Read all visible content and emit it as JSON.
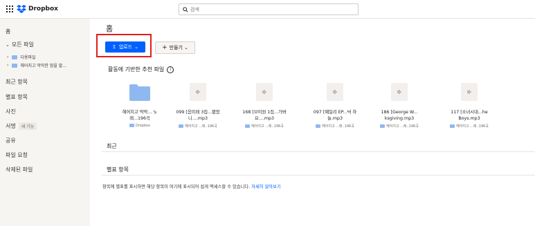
{
  "topbar": {
    "app_name": "Dropbox",
    "search_placeholder": "검색"
  },
  "sidebar": {
    "home": "홈",
    "all_files": "모든 파일",
    "tree": [
      {
        "label": "다용파일"
      },
      {
        "label": "헤어지고 막막한 맘을 말..."
      }
    ],
    "items": [
      {
        "label": "최근 항목"
      },
      {
        "label": "별표 항목"
      },
      {
        "label": "사진"
      },
      {
        "label": "서명",
        "badge": "새 기능"
      },
      {
        "label": "공유"
      },
      {
        "label": "파일 요청"
      },
      {
        "label": "삭제된 파일"
      }
    ]
  },
  "main": {
    "title": "홈",
    "upload_label": "업로드",
    "create_label": "만들기",
    "suggested_title": "활동에 기반한 추천 파일",
    "recent_title": "최근",
    "starred_title": "별표 항목",
    "starred_empty_text": "항목에 별표를 표시하면 해당 항목이 여기에 표시되어 쉽게 액세스할 수 있습니다. ",
    "learn_more": "자세히 알아보기"
  },
  "cards": [
    {
      "type": "folder",
      "name1": "헤어지고 막막... 노",
      "name2": "래...196곡",
      "location": "Dropbox"
    },
    {
      "type": "audio",
      "name1": "099 [음미래 3집...됐었",
      "name2": "니....mp3",
      "location": "헤어지고 ...래..196곡"
    },
    {
      "type": "audio",
      "name1": "168 [브이원 1집...가봐",
      "name2": "요....mp3",
      "location": "헤어지고 ...래..196곡"
    },
    {
      "type": "audio",
      "name1": "097 [예일리 EP...넉 하",
      "name2": "늘.mp3",
      "location": "헤어지고 ...래..196곡"
    },
    {
      "type": "audio",
      "name1": "186 [George W...",
      "name2": "ksgiving.mp3",
      "location": "헤어지고 ...래..196곡"
    },
    {
      "type": "audio",
      "name1": "117 [소녀시대...he",
      "name2": "Boys.mp3",
      "location": "헤어지고 ...래..196곡"
    }
  ],
  "colors": {
    "accent": "#0061fe",
    "highlight_box": "#e21b1b",
    "folder": "#8fb8f0",
    "sidebar_bg": "#f7f5f2"
  }
}
